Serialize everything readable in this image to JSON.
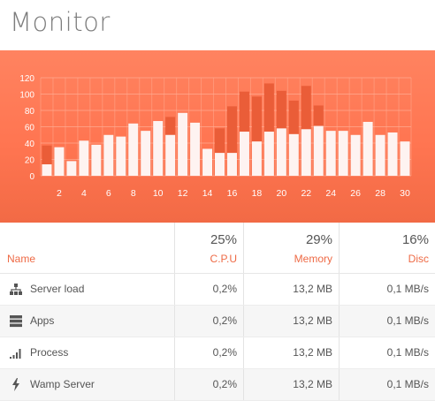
{
  "page": {
    "title": "Monitor"
  },
  "chart_data": {
    "type": "bar",
    "ylim": [
      0,
      120
    ],
    "yticks": [
      "0",
      "20",
      "40",
      "60",
      "80",
      "100",
      "120"
    ],
    "xticks": [
      "2",
      "4",
      "6",
      "8",
      "10",
      "12",
      "14",
      "16",
      "18",
      "20",
      "22",
      "24",
      "26",
      "28",
      "30"
    ],
    "x": [
      1,
      2,
      3,
      4,
      5,
      6,
      7,
      8,
      9,
      10,
      11,
      12,
      13,
      14,
      15,
      16,
      17,
      18,
      19,
      20,
      21,
      22,
      23,
      24,
      25,
      26,
      27,
      28,
      29,
      30
    ],
    "series": [
      {
        "values": [
          37,
          35,
          18,
          43,
          38,
          50,
          48,
          64,
          55,
          67,
          72,
          77,
          65,
          33,
          58,
          85,
          103,
          97,
          113,
          104,
          92,
          110,
          86,
          55,
          55,
          50,
          66,
          50,
          53,
          42
        ]
      },
      {
        "values": [
          14,
          35,
          18,
          43,
          38,
          50,
          48,
          64,
          55,
          67,
          50,
          77,
          65,
          33,
          28,
          28,
          54,
          42,
          54,
          58,
          51,
          57,
          61,
          55,
          55,
          50,
          66,
          50,
          53,
          42
        ]
      }
    ],
    "colors": {
      "background": "#ff7b56",
      "back_bars": "#ea5d38",
      "front_bars": "#ffffff",
      "grid": "#ffad94",
      "ticks": "#ffffff"
    }
  },
  "stats": {
    "columns": [
      {
        "label": "Name",
        "value": ""
      },
      {
        "label": "C.P.U",
        "value": "25%"
      },
      {
        "label": "Memory",
        "value": "29%"
      },
      {
        "label": "Disc",
        "value": "16%"
      }
    ],
    "rows": [
      {
        "icon": "sitemap-icon",
        "name": "Server load",
        "cpu": "0,2%",
        "memory": "13,2 MB",
        "disc": "0,1 MB/s"
      },
      {
        "icon": "server-icon",
        "name": "Apps",
        "cpu": "0,2%",
        "memory": "13,2 MB",
        "disc": "0,1 MB/s"
      },
      {
        "icon": "signal-icon",
        "name": "Process",
        "cpu": "0,2%",
        "memory": "13,2 MB",
        "disc": "0,1 MB/s"
      },
      {
        "icon": "bolt-icon",
        "name": "Wamp Server",
        "cpu": "0,2%",
        "memory": "13,2 MB",
        "disc": "0,1 MB/s"
      }
    ],
    "accent": "#ee6a45"
  }
}
